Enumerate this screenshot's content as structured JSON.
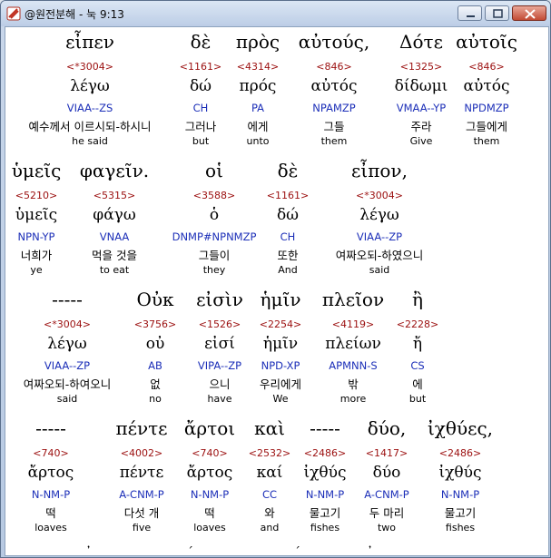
{
  "window": {
    "title": "@원전분해 - 눅 9:13"
  },
  "colors": {
    "strong": "#9b0f0f",
    "morph": "#1c2fb8",
    "titlebar": "#bccde6"
  },
  "rows": [
    [
      {
        "greek": "εἶπεν",
        "strong": "<*3004>",
        "lemma": "λέγω",
        "morph": "VIAA--ZS",
        "korean": "예수께서 이르시되-하시니",
        "english": "he said"
      },
      {
        "greek": "δὲ",
        "strong": "<1161>",
        "lemma": "δώ",
        "morph": "CH",
        "korean": "그러나",
        "english": "but"
      },
      {
        "greek": "πρὸς",
        "strong": "<4314>",
        "lemma": "πρός",
        "morph": "PA",
        "korean": "에게",
        "english": "unto"
      },
      {
        "greek": "αὐτούς,",
        "strong": "<846>",
        "lemma": "αὐτός",
        "morph": "NPAMZP",
        "korean": "그들",
        "english": "them"
      },
      {
        "greek": "Δότε",
        "strong": "<1325>",
        "lemma": "δίδωμι",
        "morph": "VMAA--YP",
        "korean": "주라",
        "english": "Give"
      },
      {
        "greek": "αὐτοῖς",
        "strong": "<846>",
        "lemma": "αὐτός",
        "morph": "NPDMZP",
        "korean": "그들에게",
        "english": "them"
      }
    ],
    [
      {
        "greek": "ὑμεῖς",
        "strong": "<5210>",
        "lemma": "ὑμεῖς",
        "morph": "NPN-YP",
        "korean": "너희가",
        "english": "ye"
      },
      {
        "greek": "φαγεῖν.",
        "strong": "<5315>",
        "lemma": "φάγω",
        "morph": "VNAA",
        "korean": "먹을 것을",
        "english": "to eat"
      },
      {
        "greek": "οἱ",
        "strong": "<3588>",
        "lemma": "ὁ",
        "morph": "DNMP#NPNMZP",
        "korean": "그들이",
        "english": "they"
      },
      {
        "greek": "δὲ",
        "strong": "<1161>",
        "lemma": "δώ",
        "morph": "CH",
        "korean": "또한",
        "english": "And"
      },
      {
        "greek": "εἶπον,",
        "strong": "<*3004>",
        "lemma": "λέγω",
        "morph": "VIAA--ZP",
        "korean": "여짜오되-하였으니",
        "english": "said"
      }
    ],
    [
      {
        "greek": "-----",
        "strong": "<*3004>",
        "lemma": "λέγω",
        "morph": "VIAA--ZP",
        "korean": "여짜오되-하여오니",
        "english": "said"
      },
      {
        "greek": "Οὐκ",
        "strong": "<3756>",
        "lemma": "οὐ",
        "morph": "AB",
        "korean": "없",
        "english": "no"
      },
      {
        "greek": "εἰσὶν",
        "strong": "<1526>",
        "lemma": "εἰσί",
        "morph": "VIPA--ZP",
        "korean": "으니",
        "english": "have"
      },
      {
        "greek": "ἡμῖν",
        "strong": "<2254>",
        "lemma": "ἡμῖν",
        "morph": "NPD-XP",
        "korean": "우리에게",
        "english": "We"
      },
      {
        "greek": "πλεῖον",
        "strong": "<4119>",
        "lemma": "πλείων",
        "morph": "APMNN-S",
        "korean": "밖",
        "english": "more"
      },
      {
        "greek": "ἢ",
        "strong": "<2228>",
        "lemma": "ἤ",
        "morph": "CS",
        "korean": "에",
        "english": "but"
      }
    ],
    [
      {
        "greek": "-----",
        "strong": "<740>",
        "lemma": "ἄρτος",
        "morph": "N-NM-P",
        "korean": "떡",
        "english": "loaves"
      },
      {
        "greek": "πέντε",
        "strong": "<4002>",
        "lemma": "πέντε",
        "morph": "A-CNM-P",
        "korean": "다섯 개",
        "english": "five"
      },
      {
        "greek": "ἄρτοι",
        "strong": "<740>",
        "lemma": "ἄρτος",
        "morph": "N-NM-P",
        "korean": "떡",
        "english": "loaves"
      },
      {
        "greek": "καὶ",
        "strong": "<2532>",
        "lemma": "καί",
        "morph": "CC",
        "korean": "와",
        "english": "and"
      },
      {
        "greek": "-----",
        "strong": "<2486>",
        "lemma": "ἰχθύς",
        "morph": "N-NM-P",
        "korean": "물고기",
        "english": "fishes"
      },
      {
        "greek": "δύο,",
        "strong": "<1417>",
        "lemma": "δύο",
        "morph": "A-CNM-P",
        "korean": "두 마리",
        "english": "two"
      },
      {
        "greek": "ἰχθύες,",
        "strong": "<2486>",
        "lemma": "ἰχθύς",
        "morph": "N-NM-P",
        "korean": "물고기",
        "english": "fishes"
      }
    ]
  ]
}
